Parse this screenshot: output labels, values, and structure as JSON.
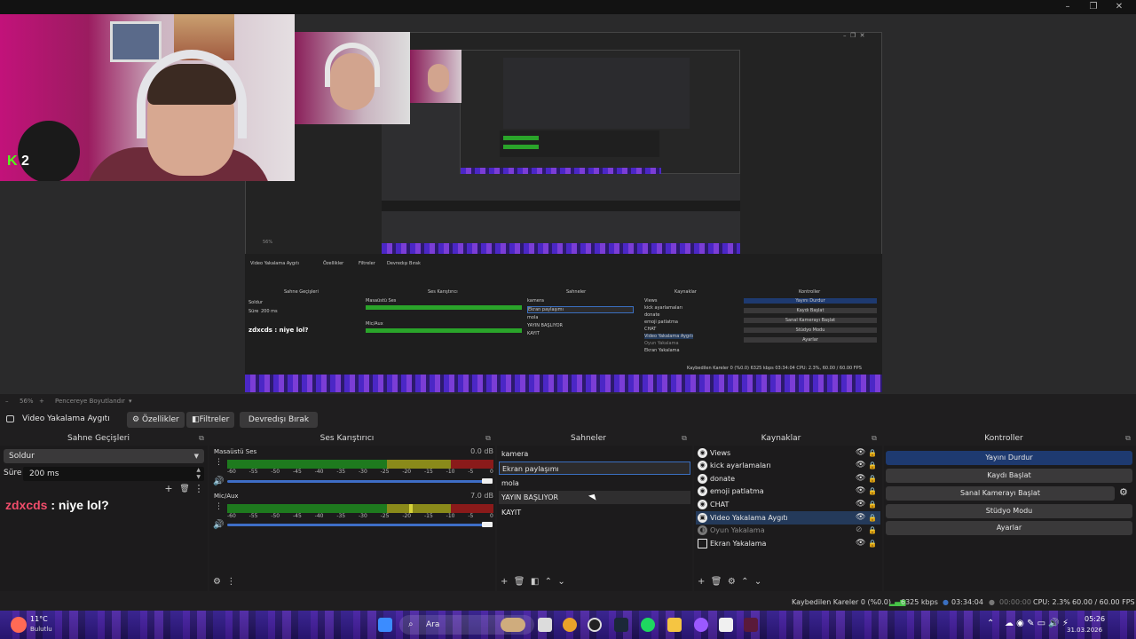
{
  "window": {
    "controls": [
      "–",
      "❐",
      "✕"
    ]
  },
  "preview": {
    "kick_count": "2",
    "nested": {
      "docks": [
        "Sahne Geçişleri",
        "Ses Karıştırıcı",
        "Sahneler",
        "Kaynaklar",
        "Kontroller"
      ],
      "toolbar": [
        "Video Yakalama Aygıtı",
        "Özellikler",
        "Filtreler",
        "Devredışı Bırak"
      ],
      "transition": "Soldur",
      "duration_label": "Süre",
      "duration": "200 ms",
      "chat": "zdxcds : niye lol?",
      "mixer": [
        "Masaüstü Ses",
        "Mic/Aux"
      ],
      "scenes": [
        "kamera",
        "Ekran paylaşımı",
        "mola",
        "YAYIN BAŞLIYOR",
        "KAYIT"
      ],
      "sources": [
        "Views",
        "kick ayarlamaları",
        "donate",
        "emoji patlatma",
        "CHAT",
        "Video Yakalama Aygıtı",
        "Oyun Yakalama",
        "Ekran Yakalama"
      ],
      "controls": [
        "Yayını Durdur",
        "Kaydı Başlat",
        "Sanal Kamerayı Başlat",
        "Stüdyo Modu",
        "Ayarlar"
      ],
      "status": "Kaybedilen Kareler 0 (%0.0)  6325 kbps  03:34:04  CPU: 2.3%, 60.00 / 60.00 FPS",
      "zoom": "56%"
    }
  },
  "zoombar": {
    "zoom": "56%",
    "label": "Pencereye Boyutlandır"
  },
  "source_toolbar": {
    "source_name": "Video Yakalama Aygıtı",
    "properties": "Özellikler",
    "filters": "Filtreler",
    "disable": "Devredışı Bırak"
  },
  "docks": {
    "transitions": {
      "title": "Sahne Geçişleri",
      "selected": "Soldur",
      "duration_label": "Süre",
      "duration_value": "200 ms"
    },
    "mixer": {
      "title": "Ses Karıştırıcı",
      "channels": [
        {
          "name": "Masaüstü Ses",
          "db": "0.0 dB",
          "level": 0.0
        },
        {
          "name": "Mic/Aux",
          "db": "7.0 dB",
          "level": 0.82
        }
      ],
      "ticks": [
        "-60",
        "-55",
        "-50",
        "-45",
        "-40",
        "-35",
        "-30",
        "-25",
        "-20",
        "-15",
        "-10",
        "-5",
        "0"
      ]
    },
    "scenes": {
      "title": "Sahneler",
      "items": [
        "kamera",
        "Ekran paylaşımı",
        "mola",
        "YAYIN BAŞLIYOR",
        "KAYIT"
      ],
      "selected_index": 1
    },
    "sources": {
      "title": "Kaynaklar",
      "items": [
        "Views",
        "kick ayarlamaları",
        "donate",
        "emoji patlatma",
        "CHAT",
        "Video Yakalama Aygıtı",
        "Oyun Yakalama",
        "Ekran Yakalama"
      ]
    },
    "controls": {
      "title": "Kontroller",
      "stop_stream": "Yayını Durdur",
      "start_record": "Kaydı Başlat",
      "start_virtualcam": "Sanal Kamerayı Başlat",
      "studio_mode": "Stüdyo Modu",
      "settings": "Ayarlar"
    }
  },
  "chat": {
    "user": "zdxcds",
    "message": ": niye lol?"
  },
  "status": {
    "dropped": "Kaybedilen Kareler 0 (%0.0)",
    "bitrate": "6325 kbps",
    "stream_time": "03:34:04",
    "record_time": "00:00:00",
    "cpu": "CPU: 2.3%",
    "fps": "60.00 / 60.00 FPS"
  },
  "taskbar": {
    "temp": "11°C",
    "weather": "Bulutlu",
    "search": "Ara",
    "time": "05:26",
    "date": "31.03.2026"
  },
  "colors": {
    "accent": "#3a6fc0",
    "active_control": "#1e3a70",
    "kick_green": "#53fc18",
    "chat_user": "#f14d6b"
  }
}
